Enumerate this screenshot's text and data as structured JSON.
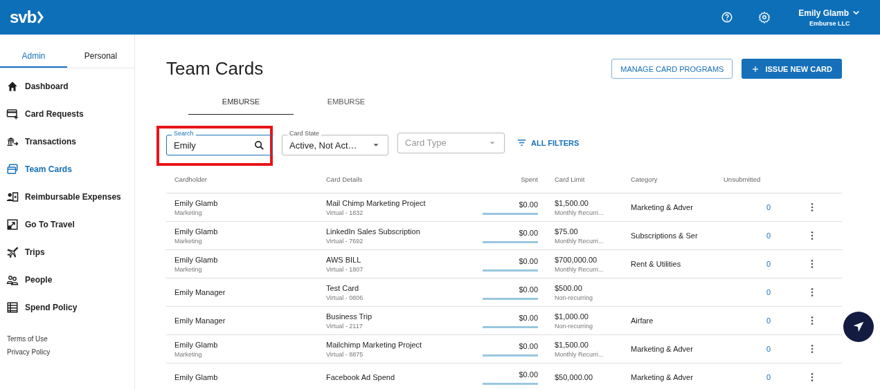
{
  "header": {
    "logo": "svb",
    "user_name": "Emily Glamb",
    "org": "Emburse LLC"
  },
  "sidebar": {
    "tabs": [
      {
        "label": "Admin",
        "selected": true
      },
      {
        "label": "Personal",
        "selected": false
      }
    ],
    "items": [
      {
        "label": "Dashboard",
        "selected": false
      },
      {
        "label": "Card Requests",
        "selected": false
      },
      {
        "label": "Transactions",
        "selected": false
      },
      {
        "label": "Team Cards",
        "selected": true
      },
      {
        "label": "Reimbursable Expenses",
        "selected": false
      },
      {
        "label": "Go To Travel",
        "selected": false
      },
      {
        "label": "Trips",
        "selected": false
      },
      {
        "label": "People",
        "selected": false
      },
      {
        "label": "Spend Policy",
        "selected": false
      }
    ],
    "footer_links": [
      "Terms of Use",
      "Privacy Policy"
    ]
  },
  "page": {
    "title": "Team Cards",
    "manage_button": "MANAGE CARD PROGRAMS",
    "issue_button": "ISSUE NEW CARD",
    "tabs": [
      {
        "label": "EMBURSE",
        "selected": true
      },
      {
        "label": "EMBURSE",
        "selected": false
      }
    ],
    "filters": {
      "search": {
        "label": "Search",
        "value": "Emily"
      },
      "card_state": {
        "label": "Card State",
        "value": "Active, Not Act…"
      },
      "card_type": {
        "placeholder": "Card Type"
      },
      "all_filters": "ALL FILTERS"
    }
  },
  "table": {
    "columns": [
      "Cardholder",
      "Card Details",
      "Spent",
      "Card Limit",
      "Category",
      "Unsubmitted"
    ],
    "rows": [
      {
        "name": "Emily Glamb",
        "dept": "Marketing",
        "card": "Mail Chimp Marketing Project",
        "card_sub": "Virtual - 1832",
        "spent": "$0.00",
        "limit": "$1,500.00",
        "limit_sub": "Monthly Recurri...",
        "category": "Marketing & Adver",
        "unsubmitted": "0"
      },
      {
        "name": "Emily Glamb",
        "dept": "Marketing",
        "card": "LinkedIn Sales Subscription",
        "card_sub": "Virtual - 7692",
        "spent": "$0.00",
        "limit": "$75.00",
        "limit_sub": "Monthly Recurri...",
        "category": "Subscriptions & Ser",
        "unsubmitted": "0"
      },
      {
        "name": "Emily Glamb",
        "dept": "Marketing",
        "card": "AWS BILL",
        "card_sub": "Virtual - 1807",
        "spent": "$0.00",
        "limit": "$700,000.00",
        "limit_sub": "Monthly Recurri...",
        "category": "Rent & Utilities",
        "unsubmitted": "0"
      },
      {
        "name": "Emily Manager",
        "card": "Test Card",
        "card_sub": "Virtual - 0806",
        "spent": "$0.00",
        "limit": "$500.00",
        "limit_sub": "Non-recurring",
        "unsubmitted": "0"
      },
      {
        "name": "Emily Manager",
        "card": "Business Trip",
        "card_sub": "Virtual - 2117",
        "spent": "$0.00",
        "limit": "$1,000.00",
        "limit_sub": "Non-recurring",
        "category": "Airfare",
        "unsubmitted": "0"
      },
      {
        "name": "Emily Glamb",
        "dept": "Marketing",
        "card": "Mailchimp Marketing Project",
        "card_sub": "Virtual - 8875",
        "spent": "$0.00",
        "limit": "$1,500.00",
        "limit_sub": "Monthly Recurri...",
        "category": "Marketing & Adver",
        "unsubmitted": "0"
      },
      {
        "name": "Emily Glamb",
        "card": "Facebook Ad Spend",
        "spent": "$0.00",
        "limit": "$50,000.00",
        "category": "Marketing & Adver",
        "unsubmitted": "0"
      }
    ]
  }
}
